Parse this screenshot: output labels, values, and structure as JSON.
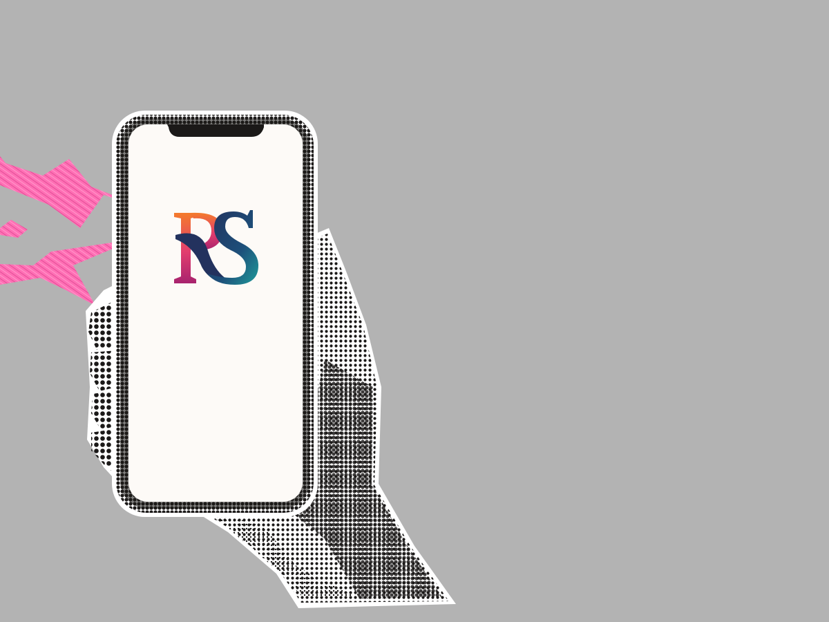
{
  "scene": {
    "background_color": "#b3b3b3",
    "halftone_color": "#1b1918",
    "cutout_outline_color": "#ffffff",
    "screen_color": "#fdfaf7",
    "lightning_color": "#ff6fb5"
  },
  "phone": {
    "notch": true,
    "screen_state": "splash",
    "logo": {
      "text": "RS",
      "gradient_colors": [
        "#f47b2b",
        "#e23d6e",
        "#23325e",
        "#1f9a9a"
      ]
    }
  },
  "hand": {
    "holding": "phone",
    "style": "halftone"
  },
  "lightning": {
    "count": 3,
    "direction": "left-of-phone"
  }
}
